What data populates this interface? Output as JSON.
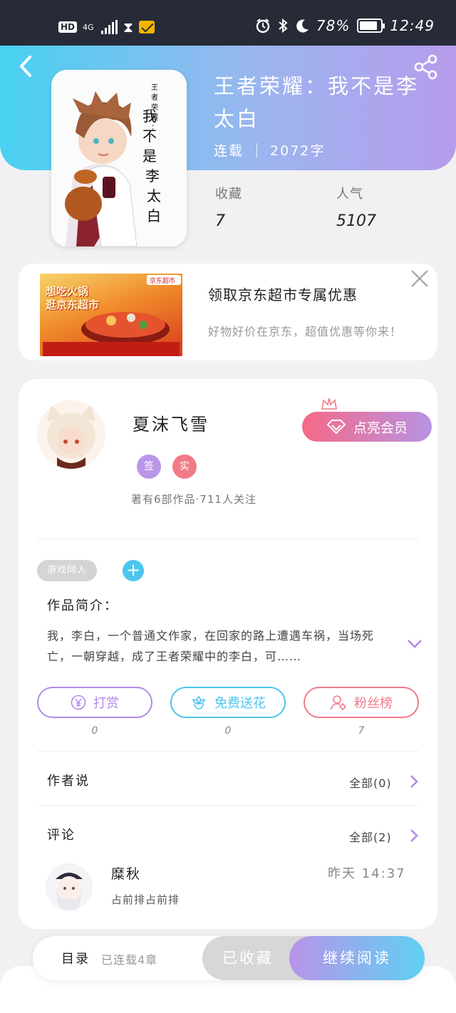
{
  "status_bar": {
    "hd": "HD",
    "network": "4G",
    "hourglass": "⧗",
    "battery": "78%",
    "time": "12:49"
  },
  "book": {
    "title": "王者荣耀：我不是李太白",
    "status": "连载",
    "words": "2072字",
    "cover_text": "王者荣耀：我不是李太白",
    "stats": [
      {
        "label": "收藏",
        "value": "7"
      },
      {
        "label": "人气",
        "value": "5107"
      }
    ]
  },
  "ad": {
    "title": "领取京东超市专属优惠",
    "subtitle": "好物好价在京东，超值优惠等你来！",
    "image_text": "想吃火锅 逛京东超市",
    "image_badge": "京东超市"
  },
  "author": {
    "name": "夏沫飞雪",
    "badges": [
      "签",
      "实"
    ],
    "stats": "著有6部作品·711人关注",
    "vip_label": "点亮会员"
  },
  "tags": [
    "游戏同人"
  ],
  "intro": {
    "label": "作品简介：",
    "text": "我，李白，一个普通文作家，在回家的路上遭遇车祸，当场死亡，一朝穿越，成了王者荣耀中的李白，可……"
  },
  "actions": [
    {
      "label": "打赏",
      "count": "0",
      "icon": "yuan-icon",
      "color": "#b18ae8"
    },
    {
      "label": "免费送花",
      "count": "0",
      "icon": "flower-icon",
      "color": "#4cc6ee"
    },
    {
      "label": "粉丝榜",
      "count": "7",
      "icon": "fans-icon",
      "color": "#f07a8a"
    }
  ],
  "author_says": {
    "label": "作者说",
    "all": "全部(0)"
  },
  "comments": {
    "label": "评论",
    "all": "全部(2)",
    "items": [
      {
        "name": "糜秋",
        "time": "昨天 14:37",
        "text": "占前排占前排"
      }
    ]
  },
  "bottom_bar": {
    "toc": "目录",
    "toc_sub": "已连载4章",
    "fav": "已收藏",
    "read": "继续阅读"
  },
  "colors": {
    "header_gradient": [
      "#48d2f2",
      "#b79cec"
    ],
    "accent_purple": "#b18ae8",
    "accent_cyan": "#4cc6ee",
    "accent_pink": "#f07a8a"
  }
}
